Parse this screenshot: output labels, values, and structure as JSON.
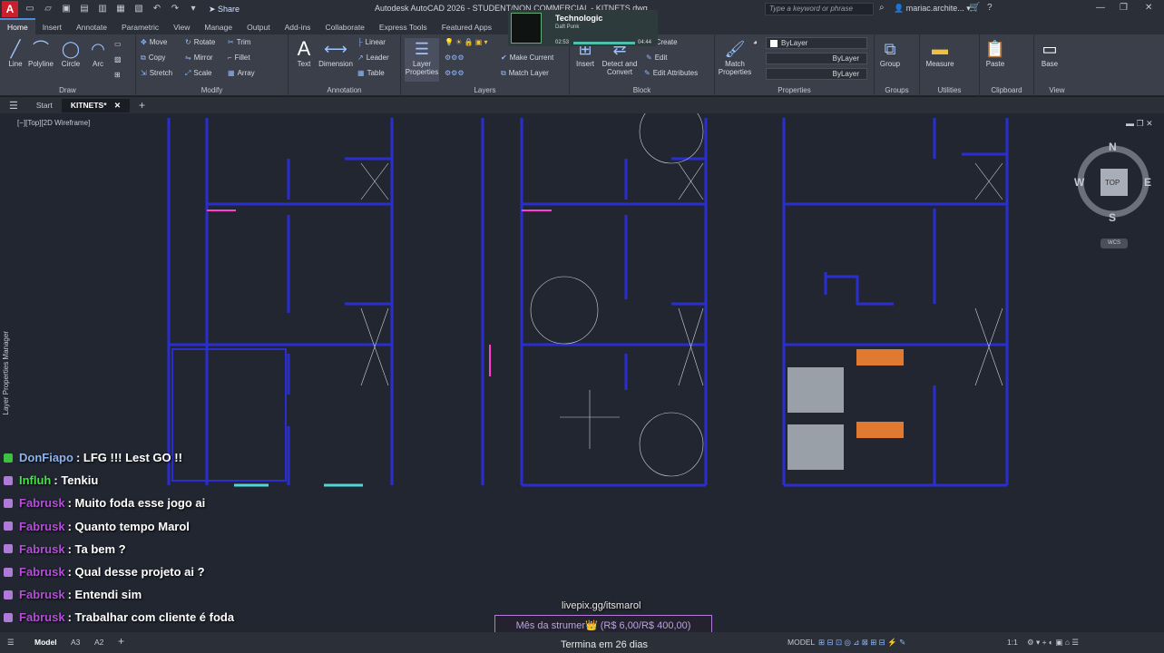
{
  "titlebar": {
    "app_letter": "A",
    "share_label": "Share",
    "title": "Autodesk AutoCAD 2026 - STUDENT/NON COMMERCIAL - KITNETS.dwg",
    "search_placeholder": "Type a keyword or phrase",
    "user": "mariac.archite..."
  },
  "ribbon_tabs": [
    "Home",
    "Insert",
    "Annotate",
    "Parametric",
    "View",
    "Manage",
    "Output",
    "Add-ins",
    "Collaborate",
    "Express Tools",
    "Featured Apps"
  ],
  "ribbon": {
    "draw": {
      "title": "Draw",
      "line": "Line",
      "polyline": "Polyline",
      "circle": "Circle",
      "arc": "Arc"
    },
    "modify": {
      "title": "Modify",
      "move": "Move",
      "rotate": "Rotate",
      "trim": "Trim",
      "copy": "Copy",
      "mirror": "Mirror",
      "fillet": "Fillet",
      "stretch": "Stretch",
      "scale": "Scale",
      "array": "Array"
    },
    "annotation": {
      "title": "Annotation",
      "text": "Text",
      "dimension": "Dimension",
      "linear": "Linear",
      "leader": "Leader",
      "table": "Table"
    },
    "layers": {
      "title": "Layers",
      "layer_properties": "Layer Properties",
      "make_current": "Make Current",
      "match_layer": "Match Layer"
    },
    "block": {
      "title": "Block",
      "insert": "Insert",
      "create": "Create",
      "edit": "Edit",
      "detect_convert": "Detect and Convert",
      "edit_attributes": "Edit Attributes"
    },
    "properties": {
      "title": "Properties",
      "match_properties": "Match Properties",
      "bylayer_1": "ByLayer",
      "bylayer_2": "ByLayer",
      "bylayer_3": "ByLayer"
    },
    "groups": {
      "title": "Groups",
      "group": "Group"
    },
    "utilities": {
      "title": "Utilities",
      "measure": "Measure"
    },
    "clipboard": {
      "title": "Clipboard",
      "paste": "Paste"
    },
    "view": {
      "title": "View",
      "base": "Base"
    }
  },
  "music_overlay": {
    "title": "Technologic",
    "artist": "Daft Punk",
    "elapsed": "02:53",
    "total": "04:44"
  },
  "doc_tabs": {
    "start": "Start",
    "active": "KITNETS*"
  },
  "viewport": {
    "label": "[−][Top][2D Wireframe]",
    "side_panel": "Layer Properties Manager"
  },
  "viewcube": {
    "n": "N",
    "s": "S",
    "e": "E",
    "w": "W",
    "top": "TOP",
    "wcs": "WCS"
  },
  "chat": [
    {
      "user": "DonFiapo",
      "message": ": LFG !!! Lest GO !!",
      "color": "#8fb3e8",
      "badge": "#3fbf3f"
    },
    {
      "user": "Influh",
      "message": ": Tenkiu",
      "color": "#48e048",
      "badge": "#b07ad8"
    },
    {
      "user": "Fabrusk",
      "message": ": Muito foda esse jogo ai",
      "color": "#b24fd6",
      "badge": "#b07ad8"
    },
    {
      "user": "Fabrusk",
      "message": ": Quanto tempo Marol",
      "color": "#b24fd6",
      "badge": "#b07ad8"
    },
    {
      "user": "Fabrusk",
      "message": ": Ta bem ?",
      "color": "#b24fd6",
      "badge": "#b07ad8"
    },
    {
      "user": "Fabrusk",
      "message": ": Qual desse projeto ai ?",
      "color": "#b24fd6",
      "badge": "#b07ad8"
    },
    {
      "user": "Fabrusk",
      "message": ": Entendi sim",
      "color": "#b24fd6",
      "badge": "#b07ad8"
    },
    {
      "user": "Fabrusk",
      "message": ": Trabalhar com cliente é foda",
      "color": "#b24fd6",
      "badge": "#b07ad8"
    }
  ],
  "donation": {
    "url": "livepix.gg/itsmarol",
    "goal": "Mês da strumer👑 (R$ 6,00/R$ 400,00)",
    "ends": "Termina em 26 dias"
  },
  "status": {
    "model_tab": "Model",
    "a3": "A3",
    "a2": "A2",
    "model_label": "MODEL",
    "scale": "1:1"
  }
}
